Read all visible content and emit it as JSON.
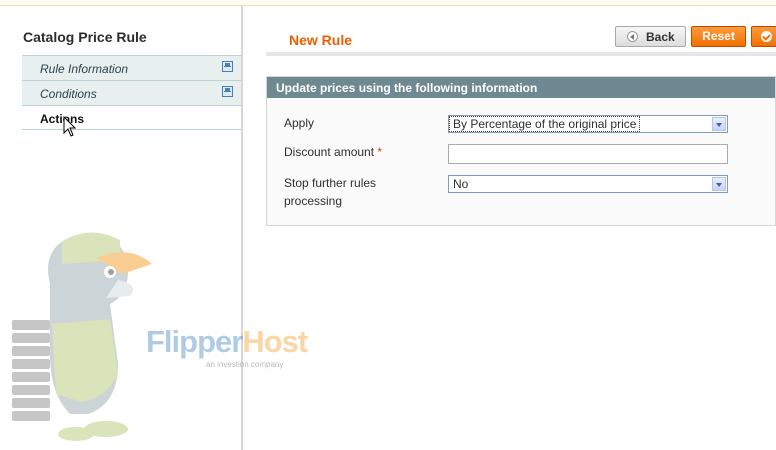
{
  "sidebar": {
    "title": "Catalog Price Rule",
    "tabs": [
      {
        "label": "Rule Information",
        "icon": "save-icon"
      },
      {
        "label": "Conditions",
        "icon": "save-icon"
      },
      {
        "label": "Actions",
        "active": true
      }
    ]
  },
  "watermark": {
    "brand_a": "Flipper",
    "brand_b": "Host",
    "tagline": "an investion company"
  },
  "header": {
    "title": "New Rule",
    "back_label": "Back",
    "reset_label": "Reset"
  },
  "section": {
    "title": "Update prices using the following information",
    "fields": {
      "apply_label": "Apply",
      "apply_value": "By Percentage of the original price",
      "discount_label": "Discount amount",
      "discount_required": "*",
      "discount_value": "",
      "stop_label_1": "Stop further rules",
      "stop_label_2": "processing",
      "stop_value": "No"
    }
  },
  "colors": {
    "accent": "#eb5e00",
    "section_header": "#6f8992",
    "button": "#f07000"
  }
}
